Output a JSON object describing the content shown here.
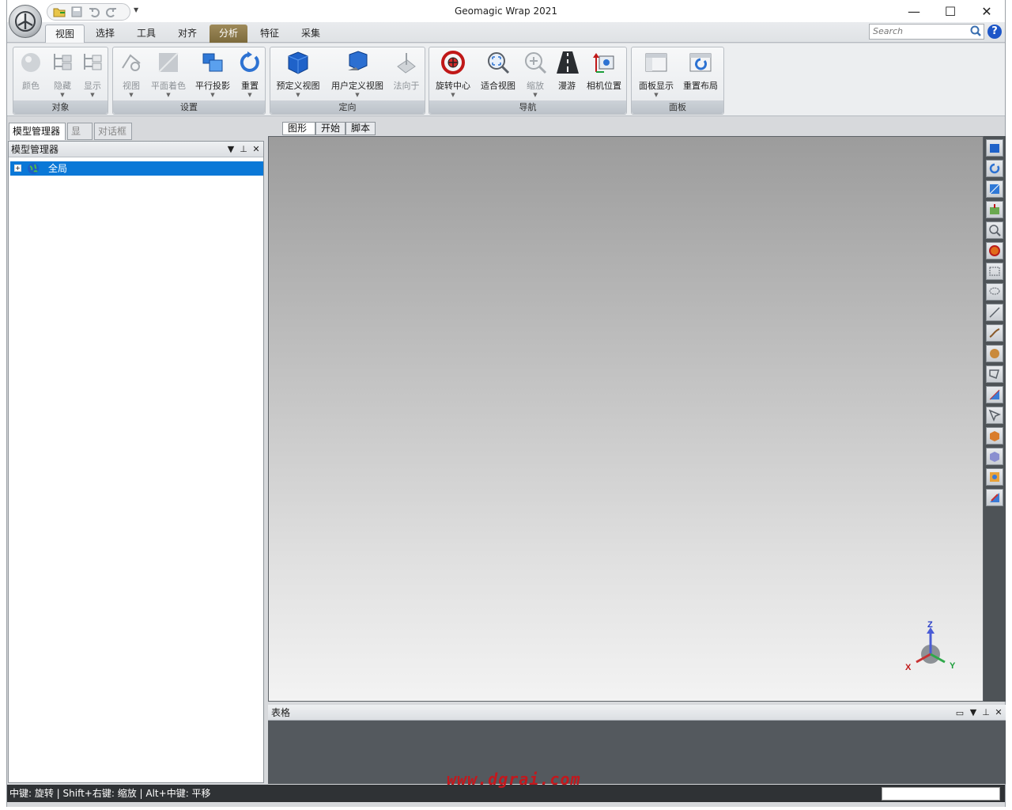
{
  "app": {
    "title": "Geomagic Wrap 2021"
  },
  "ribbon": {
    "tabs": [
      "视图",
      "选择",
      "工具",
      "对齐",
      "分析",
      "特征",
      "采集"
    ],
    "search_placeholder": "Search",
    "help": "?",
    "groups": {
      "object": {
        "label": "对象",
        "buttons": [
          "颜色",
          "隐藏",
          "显示"
        ]
      },
      "settings": {
        "label": "设置",
        "buttons": [
          "视图",
          "平面着色",
          "平行投影",
          "重置"
        ]
      },
      "orientation": {
        "label": "定向",
        "buttons": [
          "预定义视图",
          "用户定义视图",
          "法向于"
        ]
      },
      "navigation": {
        "label": "导航",
        "buttons": [
          "旋转中心",
          "适合视图",
          "缩放",
          "漫游",
          "相机位置"
        ]
      },
      "panels": {
        "label": "面板",
        "buttons": [
          "面板显示",
          "重置布局"
        ]
      }
    }
  },
  "left_dock": {
    "tabs": [
      "模型管理器",
      "显示",
      "对话框"
    ],
    "panel_title": "模型管理器",
    "tree": [
      {
        "label": "全局",
        "selected": true
      }
    ]
  },
  "viewport": {
    "tabs": [
      "图形",
      "开始",
      "脚本"
    ],
    "triad": {
      "x": "X",
      "y": "Y",
      "z": "Z"
    }
  },
  "table_panel": {
    "title": "表格"
  },
  "status": {
    "text": "中键: 旋转 | Shift+右键: 缩放 | Alt+中键: 平移"
  },
  "watermark": "www.dgrai.com",
  "colors": {
    "selection": "#0a78d7",
    "analysis_tab": "#8c7848",
    "statusbar": "#2f3235"
  }
}
